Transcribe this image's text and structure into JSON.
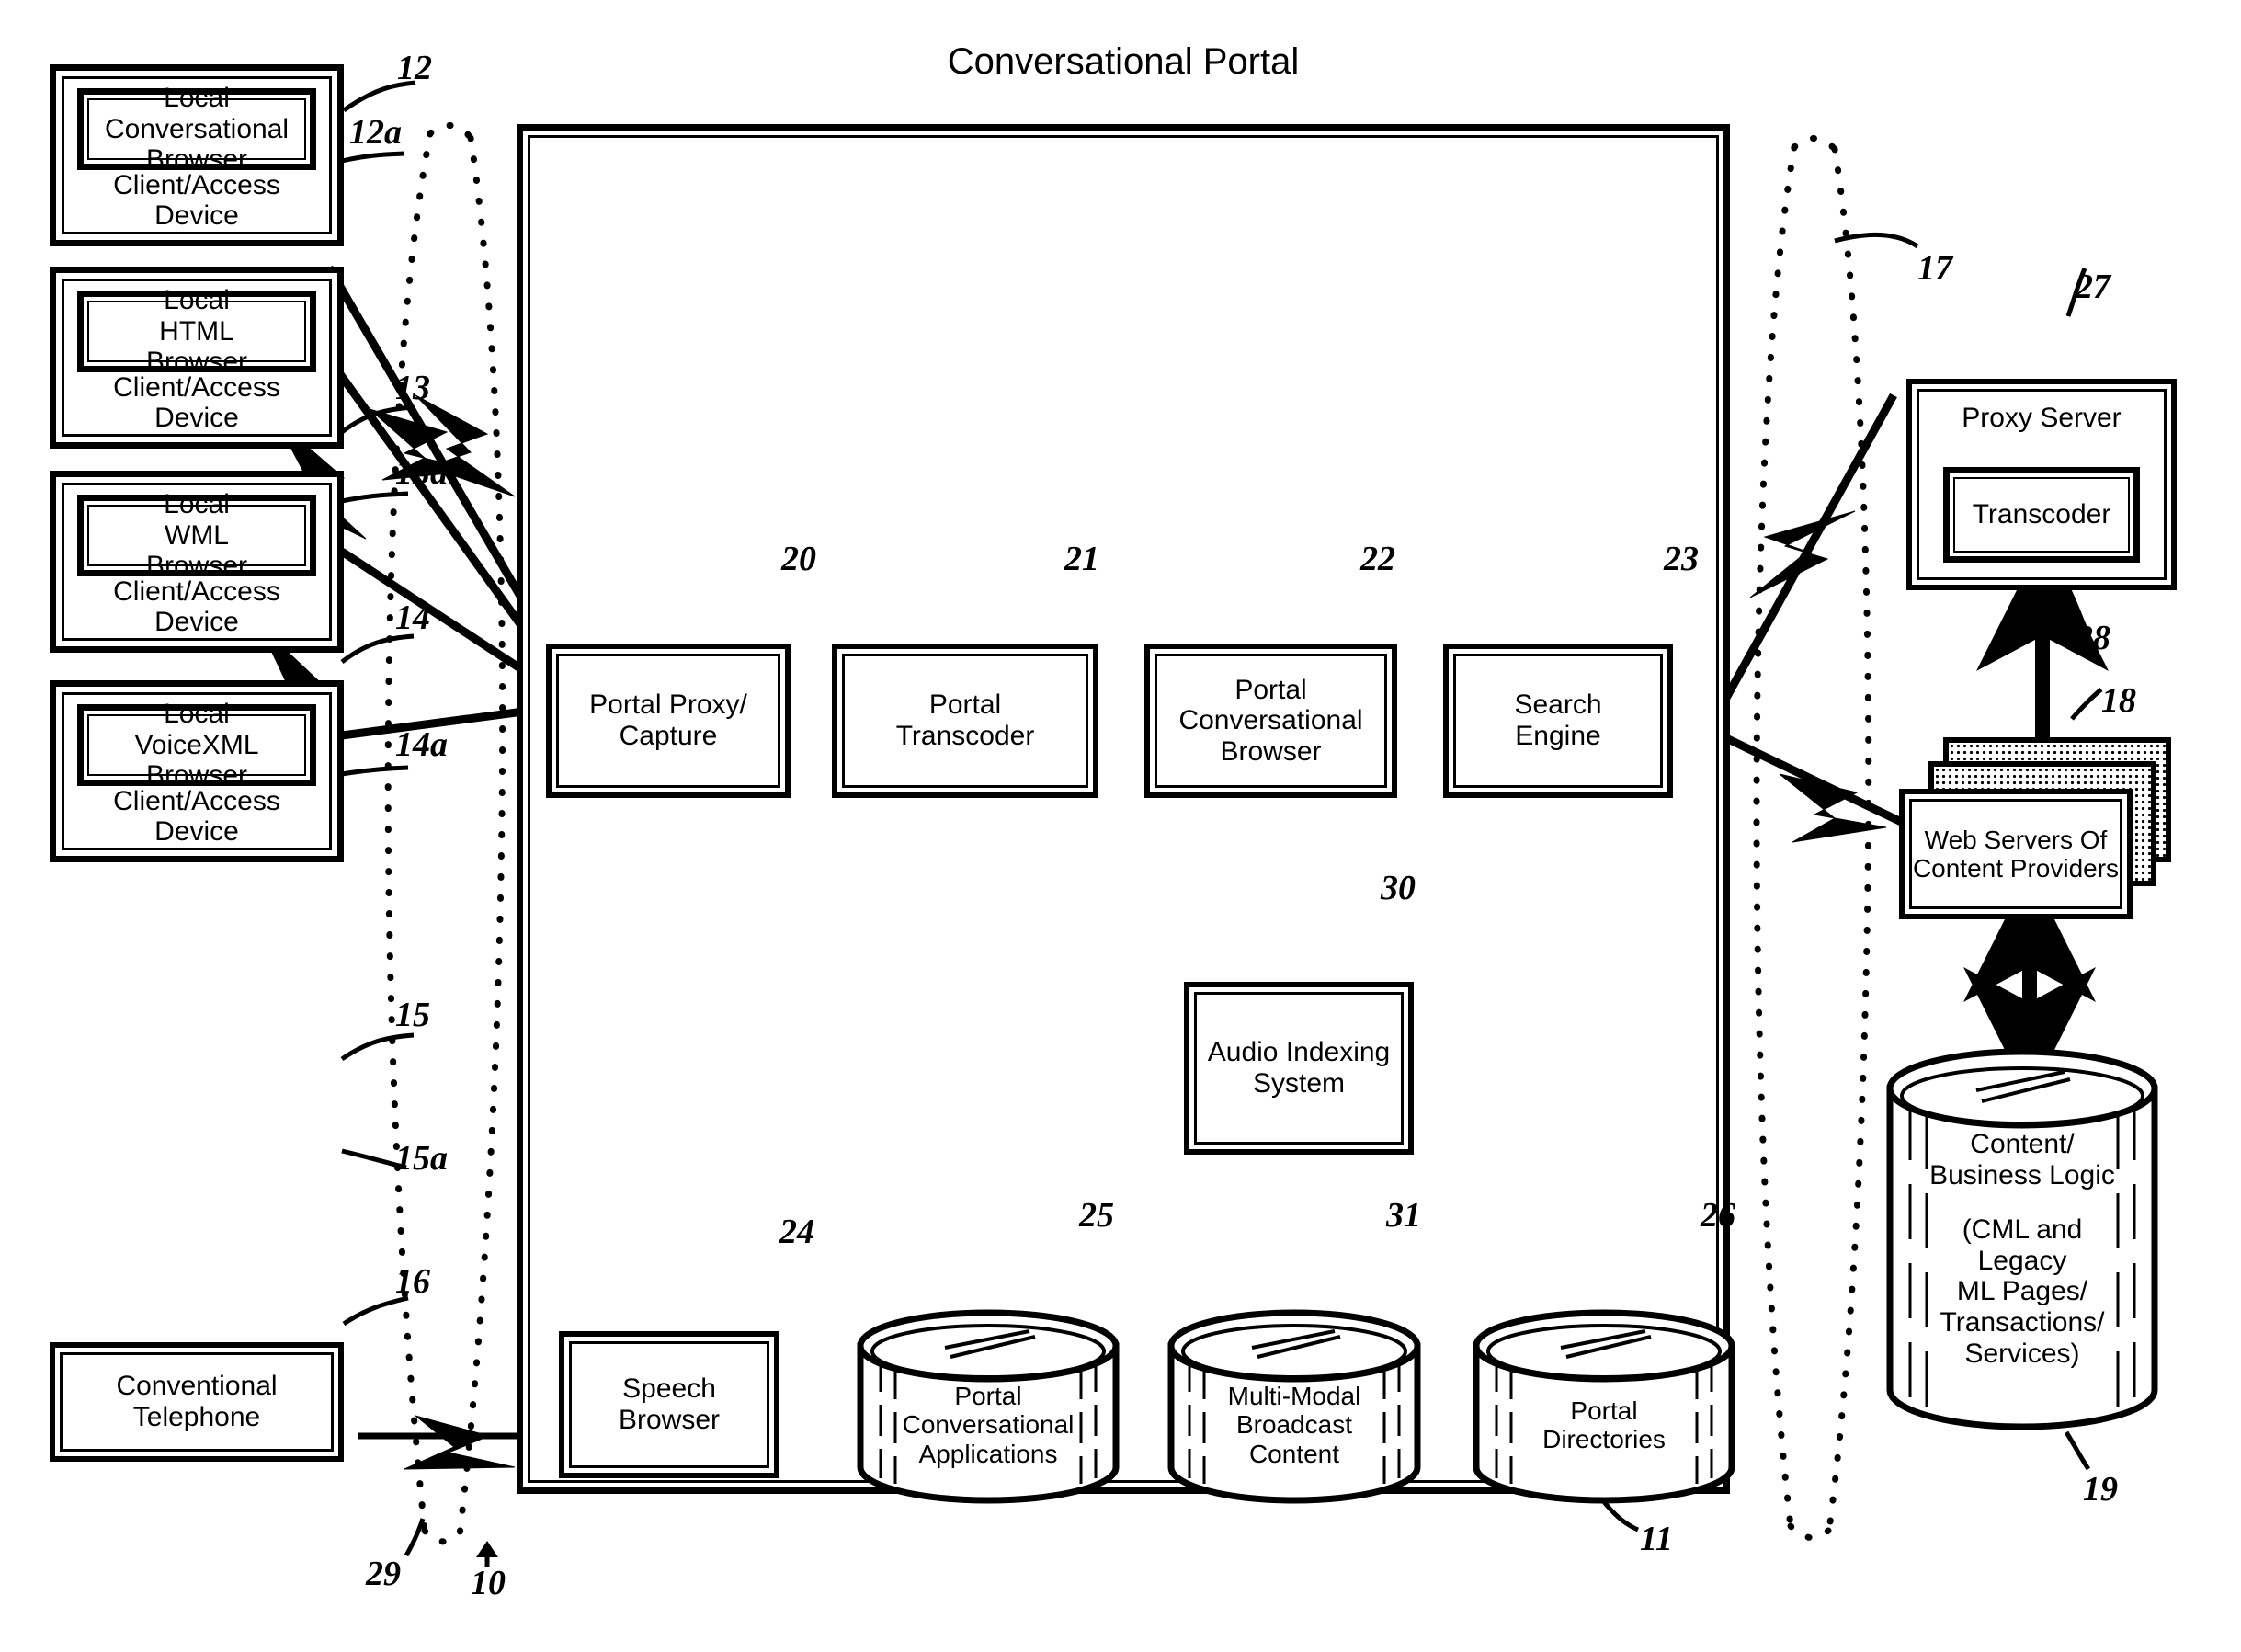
{
  "figure": {
    "title": "Conversational Portal",
    "kind": "patent-block-diagram"
  },
  "clients": [
    {
      "browser_label": "Local\nConversational\nBrowser",
      "device_label": "Client/Access\nDevice",
      "ref_outer": "12",
      "ref_inner": "12a"
    },
    {
      "browser_label": "Local\nHTML\nBrowser",
      "device_label": "Client/Access\nDevice",
      "ref_outer": "13",
      "ref_inner": "13a"
    },
    {
      "browser_label": "Local\nWML\nBrowser",
      "device_label": "Client/Access\nDevice",
      "ref_outer": "14",
      "ref_inner": "14a"
    },
    {
      "browser_label": "Local\nVoiceXML\nBrowser",
      "device_label": "Client/Access\nDevice",
      "ref_outer": "15",
      "ref_inner": "15a"
    }
  ],
  "telephone": {
    "label": "Conventional\nTelephone",
    "ref": "16"
  },
  "portal": {
    "title": "Conversational Portal",
    "ref": "11",
    "blocks": [
      {
        "label": "Portal Proxy/\nCapture",
        "ref": "20"
      },
      {
        "label": "Portal\nTranscoder",
        "ref": "21"
      },
      {
        "label": "Portal\nConversational\nBrowser",
        "ref": "22"
      },
      {
        "label": "Search\nEngine",
        "ref": "23"
      },
      {
        "label": "Speech\nBrowser",
        "ref": "24"
      },
      {
        "label": "Audio Indexing\nSystem",
        "ref": "30"
      }
    ],
    "databases": [
      {
        "label": "Portal\nConversational\nApplications",
        "ref": "25"
      },
      {
        "label": "Multi-Modal\nBroadcast\nContent",
        "ref": "31"
      },
      {
        "label": "Portal\nDirectories",
        "ref": "26"
      }
    ]
  },
  "network": {
    "client_network_ref": "29",
    "system_ref": "10",
    "content_network_ref": "17"
  },
  "right_side": {
    "proxy_server": {
      "label": "Proxy Server",
      "ref": "27"
    },
    "transcoder": {
      "label": "Transcoder",
      "ref": "28"
    },
    "web_servers": {
      "label": "Web Servers Of\nContent Providers",
      "ref": "18"
    },
    "content_store": {
      "line1": "Content/",
      "line2": "Business Logic",
      "line3": "(CML and Legacy",
      "line4": "ML Pages/",
      "line5": "Transactions/",
      "line6": "Services)",
      "ref": "19"
    }
  },
  "colors": {
    "ink": "#000000",
    "paper": "#ffffff"
  }
}
